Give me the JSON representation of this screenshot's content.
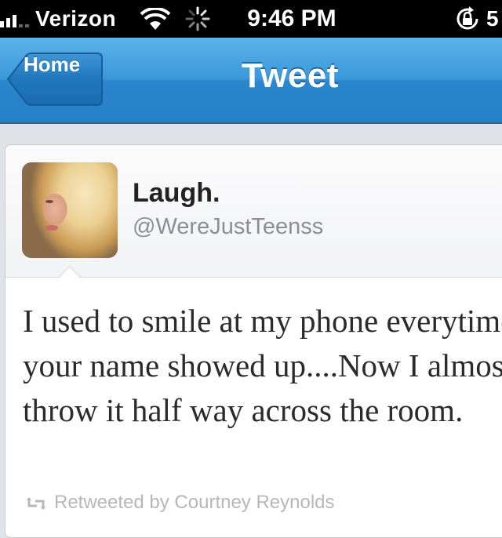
{
  "status_bar": {
    "carrier": "Verizon",
    "time": "9:46 PM",
    "battery": "5",
    "icons": [
      "signal-bars-icon",
      "wifi-icon",
      "activity-spinner-icon",
      "rotation-lock-icon"
    ]
  },
  "nav": {
    "back_label": "Home",
    "title": "Tweet",
    "accent": "#3b98da"
  },
  "tweet": {
    "name": "Laugh.",
    "handle": "@WereJustTeenss",
    "text": "I used to smile at my phone everytime your name showed up....Now I almost throw it half way across the room.",
    "retweet_line": "Retweeted by Courtney Reynolds"
  }
}
